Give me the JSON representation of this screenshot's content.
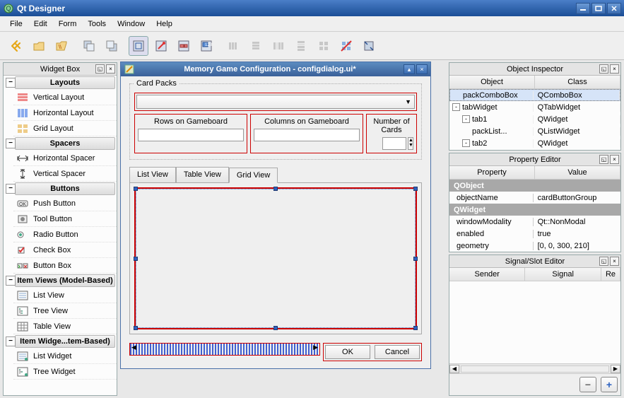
{
  "window": {
    "title": "Qt Designer"
  },
  "menus": [
    "File",
    "Edit",
    "Form",
    "Tools",
    "Window",
    "Help"
  ],
  "widgetbox": {
    "title": "Widget Box",
    "cats": [
      {
        "label": "Layouts",
        "items": [
          {
            "label": "Vertical Layout",
            "icon": "vlayout"
          },
          {
            "label": "Horizontal Layout",
            "icon": "hlayout"
          },
          {
            "label": "Grid Layout",
            "icon": "gridlayout"
          }
        ]
      },
      {
        "label": "Spacers",
        "items": [
          {
            "label": "Horizontal Spacer",
            "icon": "hspacer"
          },
          {
            "label": "Vertical Spacer",
            "icon": "vspacer"
          }
        ]
      },
      {
        "label": "Buttons",
        "items": [
          {
            "label": "Push Button",
            "icon": "pushbtn"
          },
          {
            "label": "Tool Button",
            "icon": "toolbtn"
          },
          {
            "label": "Radio Button",
            "icon": "radiobtn"
          },
          {
            "label": "Check Box",
            "icon": "checkbox"
          },
          {
            "label": "Button Box",
            "icon": "buttonbox"
          }
        ]
      },
      {
        "label": "Item Views (Model-Based)",
        "items": [
          {
            "label": "List View",
            "icon": "listview"
          },
          {
            "label": "Tree View",
            "icon": "treeview"
          },
          {
            "label": "Table View",
            "icon": "tableview"
          }
        ]
      },
      {
        "label": "Item Widge...tem-Based)",
        "items": [
          {
            "label": "List Widget",
            "icon": "listwidget"
          },
          {
            "label": "Tree Widget",
            "icon": "treewidget"
          }
        ]
      }
    ]
  },
  "form": {
    "title": "Memory Game Configuration - configdialog.ui*",
    "groupTitle": "Card Packs",
    "rowsLabel": "Rows on Gameboard",
    "colsLabel": "Columns on Gameboard",
    "numLabel": "Number of Cards",
    "tabs": [
      "List View",
      "Table View",
      "Grid View"
    ],
    "activeTab": 2,
    "okLabel": "OK",
    "cancelLabel": "Cancel"
  },
  "objectInspector": {
    "title": "Object Inspector",
    "headers": [
      "Object",
      "Class"
    ],
    "rows": [
      {
        "indent": 1,
        "exp": "",
        "obj": "packComboBox",
        "cls": "QComboBox",
        "sel": true
      },
      {
        "indent": 0,
        "exp": "-",
        "obj": "tabWidget",
        "cls": "QTabWidget"
      },
      {
        "indent": 1,
        "exp": "-",
        "obj": "tab1",
        "cls": "QWidget"
      },
      {
        "indent": 2,
        "exp": "",
        "obj": "packList...",
        "cls": "QListWidget"
      },
      {
        "indent": 1,
        "exp": "-",
        "obj": "tab2",
        "cls": "QWidget"
      }
    ]
  },
  "propertyEditor": {
    "title": "Property Editor",
    "headers": [
      "Property",
      "Value"
    ],
    "rows": [
      {
        "type": "head",
        "name": "QObject",
        "value": ""
      },
      {
        "type": "prop",
        "name": "objectName",
        "value": "cardButtonGroup"
      },
      {
        "type": "head",
        "name": "QWidget",
        "value": ""
      },
      {
        "type": "prop",
        "name": "windowModality",
        "value": "Qt::NonModal"
      },
      {
        "type": "prop",
        "name": "enabled",
        "value": "true"
      },
      {
        "type": "prop",
        "name": "geometry",
        "value": "[0, 0, 300, 210]"
      }
    ]
  },
  "signalSlot": {
    "title": "Signal/Slot Editor",
    "headers": [
      "Sender",
      "Signal",
      "Re"
    ]
  }
}
